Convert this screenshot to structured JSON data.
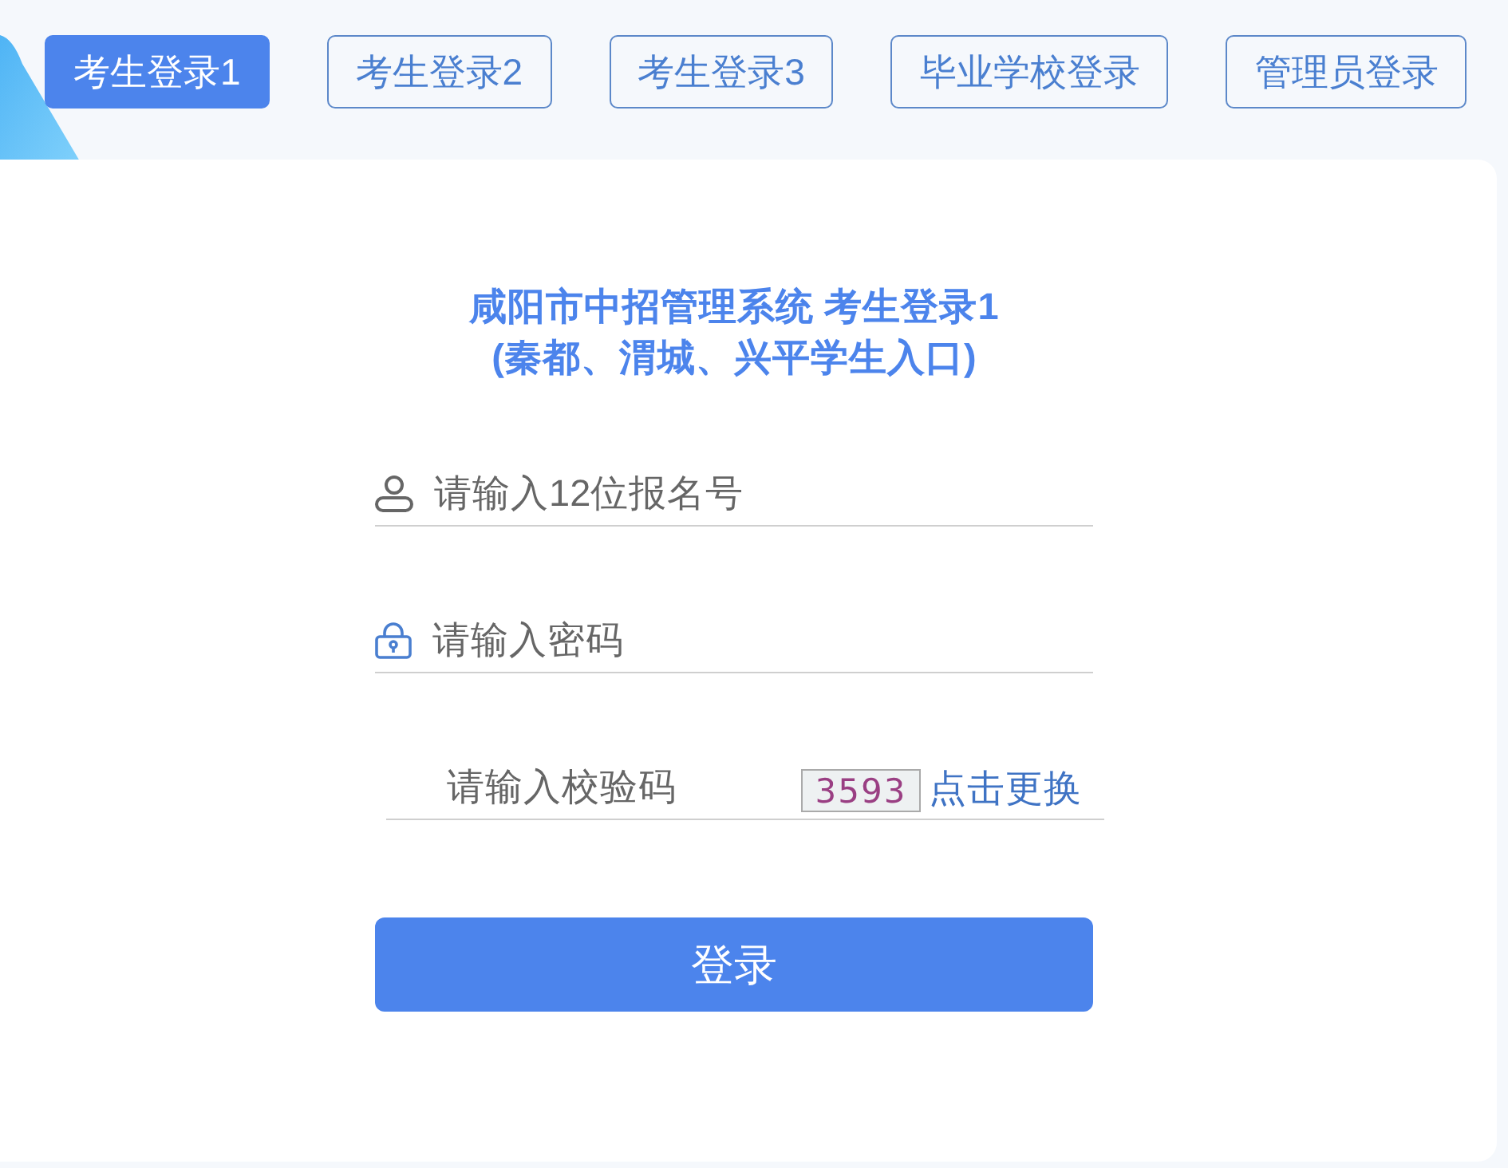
{
  "tabs": [
    {
      "label": "考生登录1",
      "selected": true
    },
    {
      "label": "考生登录2",
      "selected": false
    },
    {
      "label": "考生登录3",
      "selected": false
    },
    {
      "label": "毕业学校登录",
      "selected": false
    },
    {
      "label": "管理员登录",
      "selected": false
    }
  ],
  "login_form": {
    "title": "咸阳市中招管理系统 考生登录1",
    "subtitle": "(秦都、渭城、兴平学生入口)",
    "fields": [
      {
        "kind": "username",
        "placeholder": "请输入12位报名号"
      },
      {
        "kind": "password",
        "placeholder": "请输入密码"
      },
      {
        "kind": "captcha",
        "placeholder": "请输入校验码",
        "captcha_text": "3593",
        "refresh_link": "点击更换"
      }
    ],
    "submit_button": "登录"
  }
}
